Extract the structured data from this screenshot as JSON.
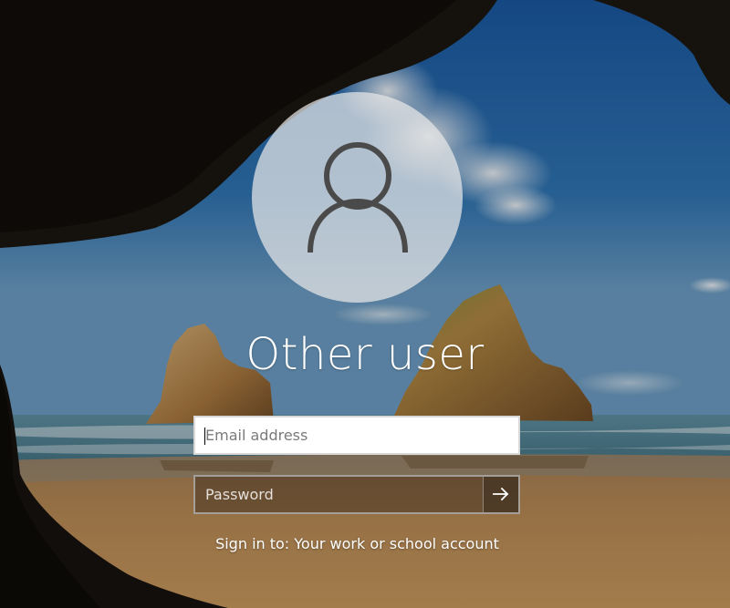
{
  "screen": {
    "username": "Other user",
    "avatar_icon": "user-silhouette-icon"
  },
  "email_field": {
    "placeholder": "Email address",
    "value": ""
  },
  "password_field": {
    "placeholder": "Password",
    "value": ""
  },
  "submit": {
    "icon": "arrow-right-icon"
  },
  "signin_target": "Sign in to: Your work or school account",
  "colors": {
    "sky": "#2a6aa8",
    "sand": "#b98a52",
    "sea": "#4a7f94",
    "cave": "#15110d",
    "avatar_fill": "#e8e8e8",
    "avatar_icon": "#4a4a4a"
  }
}
